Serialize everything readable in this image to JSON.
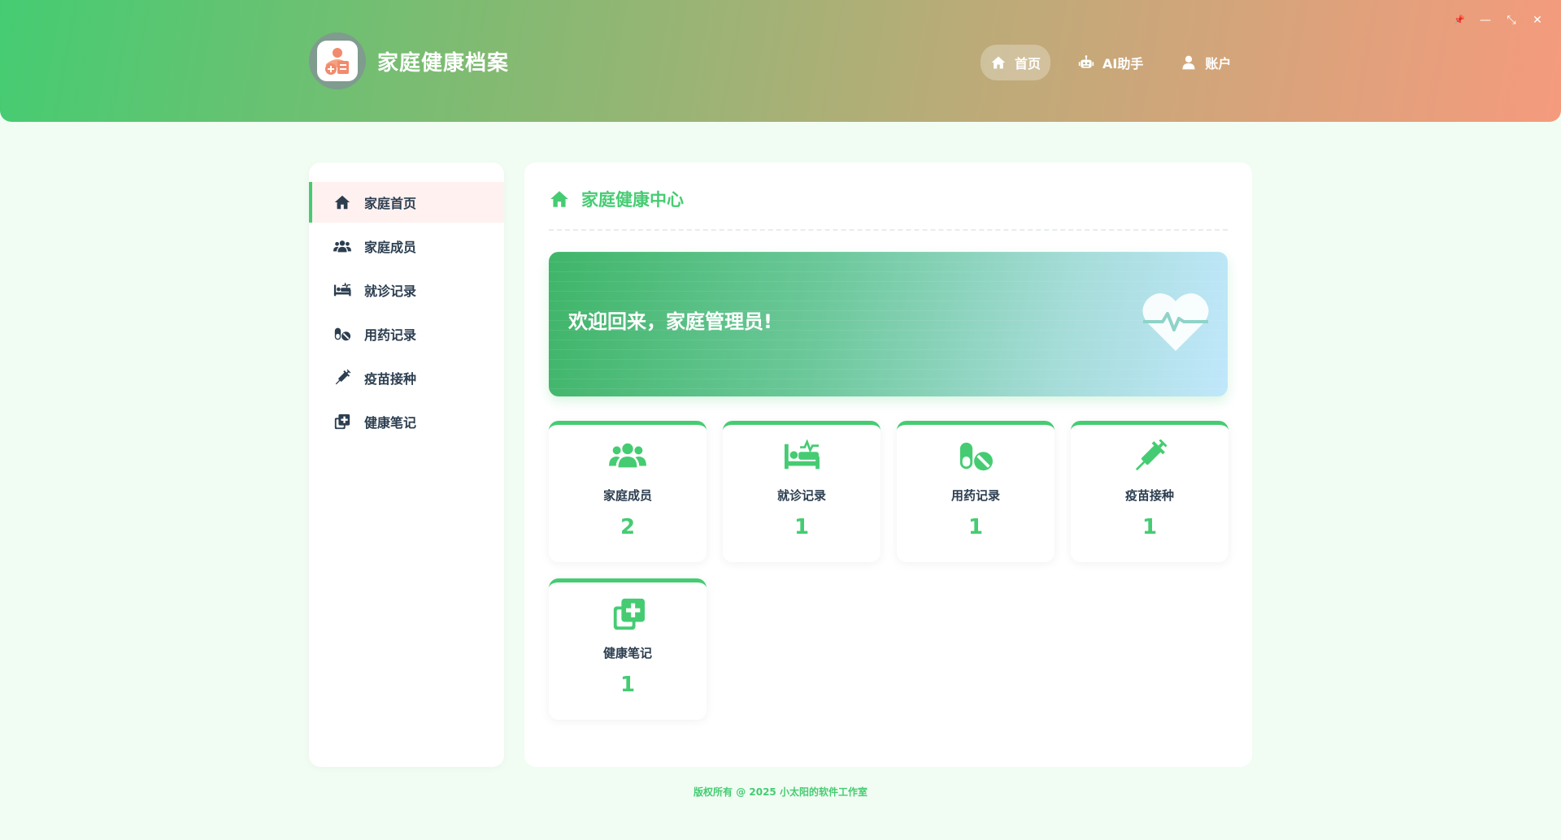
{
  "app": {
    "title": "家庭健康档案"
  },
  "window_controls": {
    "pin": "📌",
    "minimize": "—",
    "restore": "⤡",
    "close": "✕"
  },
  "topnav": [
    {
      "label": "首页",
      "icon": "home-icon",
      "active": true
    },
    {
      "label": "AI助手",
      "icon": "robot-icon",
      "active": false
    },
    {
      "label": "账户",
      "icon": "user-icon",
      "active": false
    }
  ],
  "sidebar": {
    "items": [
      {
        "label": "家庭首页",
        "icon": "home-icon",
        "active": true
      },
      {
        "label": "家庭成员",
        "icon": "users-icon",
        "active": false
      },
      {
        "label": "就诊记录",
        "icon": "bed-icon",
        "active": false
      },
      {
        "label": "用药记录",
        "icon": "pills-icon",
        "active": false
      },
      {
        "label": "疫苗接种",
        "icon": "syringe-icon",
        "active": false
      },
      {
        "label": "健康笔记",
        "icon": "notes-medical-icon",
        "active": false
      }
    ]
  },
  "main": {
    "title": "家庭健康中心",
    "banner": {
      "text": "欢迎回来，家庭管理员!"
    },
    "cards": [
      {
        "label": "家庭成员",
        "value": "2",
        "icon": "users-icon"
      },
      {
        "label": "就诊记录",
        "value": "1",
        "icon": "bed-icon"
      },
      {
        "label": "用药记录",
        "value": "1",
        "icon": "pills-icon"
      },
      {
        "label": "疫苗接种",
        "value": "1",
        "icon": "syringe-icon"
      },
      {
        "label": "健康笔记",
        "value": "1",
        "icon": "notes-medical-icon"
      }
    ]
  },
  "footer": {
    "text": "版权所有 @ 2025 小太阳的软件工作室"
  },
  "colors": {
    "accent": "#45cc72",
    "text": "#2c3e50",
    "background": "#f1fcf3"
  }
}
